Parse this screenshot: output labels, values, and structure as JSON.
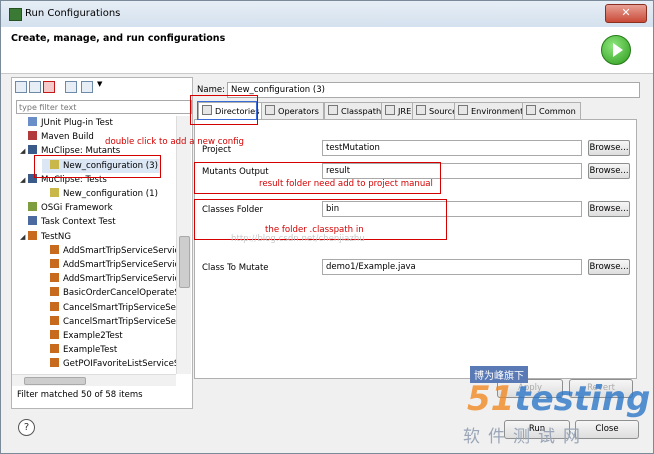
{
  "window": {
    "title": "Run Configurations",
    "close_glyph": "✕"
  },
  "header": {
    "text": "Create, manage, and run configurations"
  },
  "left": {
    "filter_placeholder": "type filter text",
    "tree": [
      {
        "label": "JUnit Plug-in Test",
        "icon": "junit-plugin-icon",
        "indent": 1,
        "expander": ""
      },
      {
        "label": "Maven Build",
        "icon": "maven-icon",
        "indent": 1,
        "expander": "",
        "prefix": "m2"
      },
      {
        "label": "MuClipse: Mutants",
        "icon": "muclipse-icon",
        "indent": 1,
        "expander": "◢"
      },
      {
        "label": "New_configuration (3)",
        "icon": "config-icon",
        "indent": 2,
        "expander": "",
        "selected": true
      },
      {
        "label": "MuClipse: Tests",
        "icon": "muclipse-tests-icon",
        "indent": 1,
        "expander": "◢"
      },
      {
        "label": "New_configuration (1)",
        "icon": "config-icon",
        "indent": 2,
        "expander": ""
      },
      {
        "label": "OSGi Framework",
        "icon": "osgi-icon",
        "indent": 1,
        "expander": ""
      },
      {
        "label": "Task Context Test",
        "icon": "task-context-icon",
        "indent": 1,
        "expander": "",
        "prefix": "Ju"
      },
      {
        "label": "TestNG",
        "icon": "testng-icon",
        "indent": 1,
        "expander": "◢"
      },
      {
        "label": "AddSmartTripServiceService",
        "icon": "testng-config-icon",
        "indent": 2,
        "expander": ""
      },
      {
        "label": "AddSmartTripServiceService",
        "icon": "testng-config-icon",
        "indent": 2,
        "expander": ""
      },
      {
        "label": "AddSmartTripServiceService",
        "icon": "testng-config-icon",
        "indent": 2,
        "expander": ""
      },
      {
        "label": "BasicOrderCancelOperateSe",
        "icon": "testng-config-icon",
        "indent": 2,
        "expander": ""
      },
      {
        "label": "CancelSmartTripServiceServ",
        "icon": "testng-config-icon",
        "indent": 2,
        "expander": ""
      },
      {
        "label": "CancelSmartTripServiceServ",
        "icon": "testng-config-icon",
        "indent": 2,
        "expander": ""
      },
      {
        "label": "Example2Test",
        "icon": "testng-config-icon",
        "indent": 2,
        "expander": ""
      },
      {
        "label": "ExampleTest",
        "icon": "testng-config-icon",
        "indent": 2,
        "expander": ""
      },
      {
        "label": "GetPOIFavoriteListServiceSe",
        "icon": "testng-config-icon",
        "indent": 2,
        "expander": ""
      }
    ],
    "status": "Filter matched 50 of 58 items"
  },
  "right": {
    "name_label": "Name:",
    "name_value": "New_configuration (3)",
    "tabs": [
      {
        "label": "Directories",
        "active": true
      },
      {
        "label": "Operators"
      },
      {
        "label": "Classpath"
      },
      {
        "label": "JRE"
      },
      {
        "label": "Source"
      },
      {
        "label": "Environment"
      },
      {
        "label": "Common"
      }
    ],
    "fields": {
      "project": {
        "label": "Project",
        "value": "testMutation"
      },
      "mutants_output": {
        "label": "Mutants Output",
        "value": "result"
      },
      "classes_folder": {
        "label": "Classes Folder",
        "value": "bin"
      },
      "class_to_mutate": {
        "label": "Class To Mutate",
        "value": "demo1/Example.java"
      }
    },
    "browse_label": "Browse...",
    "apply_label": "Apply",
    "revert_label": "Revert"
  },
  "bottom": {
    "help_glyph": "?",
    "run_label": "Run",
    "close_label": "Close"
  },
  "annotations": {
    "double_click": "double click to add a new config",
    "result_folder": "result folder need add to project manual",
    "classpath": "the folder .classpath in"
  },
  "watermark": {
    "url": "http://blog.csdn.net/chenjiazhu",
    "badge": "博为峰旗下",
    "logo_prefix": "51",
    "logo_rest": "testing",
    "subtitle": "软件测试网"
  }
}
